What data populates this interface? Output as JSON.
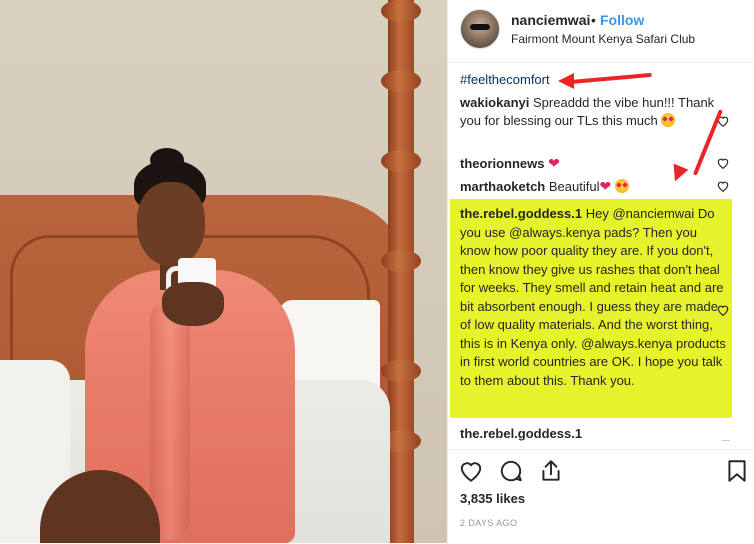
{
  "post": {
    "username": "nanciemwai",
    "separator": "•",
    "follow_label": "Follow",
    "location": "Fairmont Mount Kenya Safari Club"
  },
  "comments": {
    "hashtag": "#feelthecomfort",
    "items": [
      {
        "user": "wakiokanyi",
        "text": "Spreaddd the vibe hun!!! Thank you for blessing our TLs this much",
        "emoji": "heart-eyes"
      },
      {
        "user": "theorionnews",
        "text": "",
        "emoji": "red-heart"
      },
      {
        "user": "marthaoketch",
        "text": "Beautiful",
        "emoji": "red-heart heart-eyes"
      },
      {
        "user": "the.rebel.goddess.1",
        "text": "Hey @nanciemwai Do you use @always.kenya pads? Then you know how poor quality they are. If you don't, then know they give us rashes that don't heal for weeks. They smell and retain heat and are bit absorbent enough. I guess they are made of low quality materials. And the worst thing, this is in Kenya only. @always.kenya products in first world countries are OK. I hope you talk to them about this. Thank you."
      },
      {
        "user": "the.rebel.goddess.1",
        "text": ""
      }
    ]
  },
  "footer": {
    "likes": "3,835 likes",
    "time": "2 DAYS AGO"
  },
  "colors": {
    "accent": "#3897f0",
    "highlight": "#e6f22a",
    "annotation_arrow": "#ea2525"
  },
  "icons": [
    "heart-icon",
    "comment-icon",
    "share-icon",
    "bookmark-icon"
  ]
}
